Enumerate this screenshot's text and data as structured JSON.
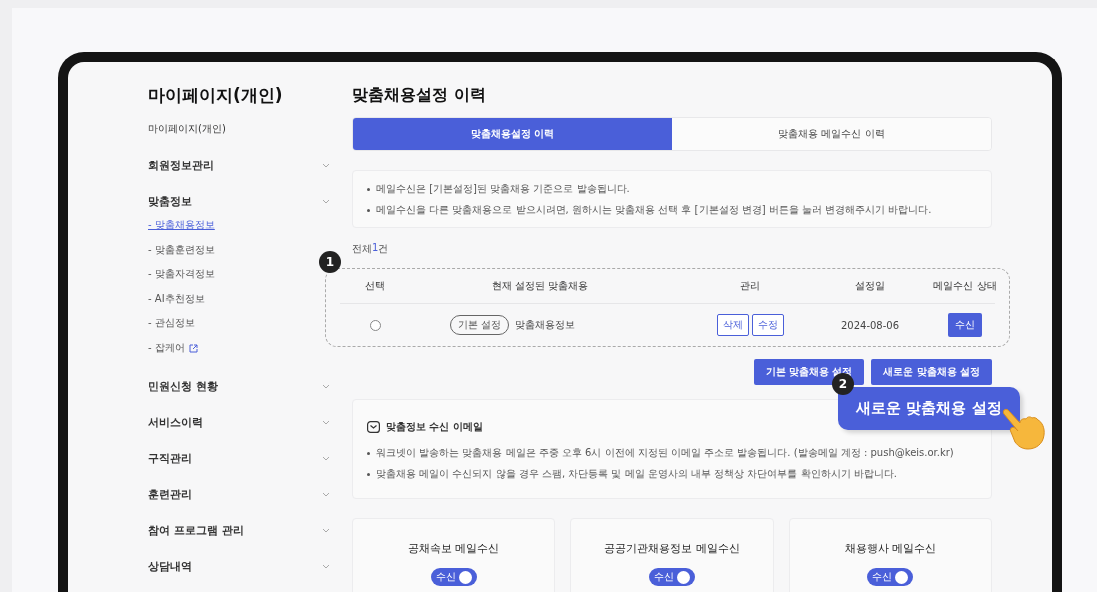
{
  "sidebar": {
    "title": "마이페이지(개인)",
    "items": [
      {
        "kind": "page",
        "label": "마이페이지(개인)"
      },
      {
        "kind": "section",
        "label": "회원정보관리"
      },
      {
        "kind": "section",
        "label": "맞춤정보",
        "children": [
          {
            "label": "- 맞춤채용정보",
            "selected": true,
            "external": false
          },
          {
            "label": "- 맞춤훈련정보",
            "selected": false,
            "external": false
          },
          {
            "label": "- 맞춤자격정보",
            "selected": false,
            "external": false
          },
          {
            "label": "- AI추천정보",
            "selected": false,
            "external": false
          },
          {
            "label": "- 관심정보",
            "selected": false,
            "external": false
          },
          {
            "label": "- 잡케어",
            "selected": false,
            "external": true
          }
        ]
      },
      {
        "kind": "section",
        "label": "민원신청 현황"
      },
      {
        "kind": "section",
        "label": "서비스이력"
      },
      {
        "kind": "section",
        "label": "구직관리"
      },
      {
        "kind": "section",
        "label": "훈련관리"
      },
      {
        "kind": "section",
        "label": "참여 프로그램 관리"
      },
      {
        "kind": "section",
        "label": "상담내역"
      }
    ]
  },
  "page_title": "맞춤채용설정 이력",
  "tabs": [
    {
      "label": "맞춤채용설정 이력",
      "selected": true
    },
    {
      "label": "맞춤채용 메일수신 이력",
      "selected": false
    }
  ],
  "notices": [
    "메일수신은 [기본설정]된 맞춤채용 기준으로 발송됩니다.",
    "메일수신을 다른 맞춤채용으로 받으시려면, 원하시는 맞춤채용 선택 후 [기본설정 변경] 버튼을 눌러 변경해주시기 바랍니다."
  ],
  "count": {
    "prefix": "전체 ",
    "number": "1",
    "suffix": "건"
  },
  "table": {
    "columns": [
      "선택",
      "현재 설정된 맞춤채용",
      "관리",
      "설정일",
      "메일수신 상태"
    ],
    "rows": [
      {
        "selected": false,
        "tag": "기본 설정",
        "name": "맞춤채용정보",
        "actions": [
          "삭제",
          "수정"
        ],
        "date": "2024-08-06",
        "status": "수신"
      }
    ]
  },
  "table_actions": [
    "기본 맞춤채용 설정",
    "새로운 맞춤채용 설정"
  ],
  "annotations": [
    {
      "number": "1"
    },
    {
      "number": "2",
      "callout": "새로운 맞춤채용 설정"
    }
  ],
  "email_info": {
    "title": "맞춤정보 수신 이메일",
    "notes": [
      "워크넷이 발송하는 맞춤채용 메일은 주중 오후 6시 이전에 지정된 이메일 주소로 발송됩니다. (발송메일 계정 : push@keis.or.kr)",
      "맞춤채용 메일이 수신되지 않을 경우 스팸, 차단등록 및 메일 운영사의 내부 정책상 차단여부를 확인하시기 바랍니다."
    ]
  },
  "subscriptions": [
    {
      "title": "공채속보 메일수신",
      "toggle_label": "수신",
      "on": true
    },
    {
      "title": "공공기관채용정보 메일수신",
      "toggle_label": "수신",
      "on": true
    },
    {
      "title": "채용행사 메일수신",
      "toggle_label": "수신",
      "on": true
    }
  ]
}
